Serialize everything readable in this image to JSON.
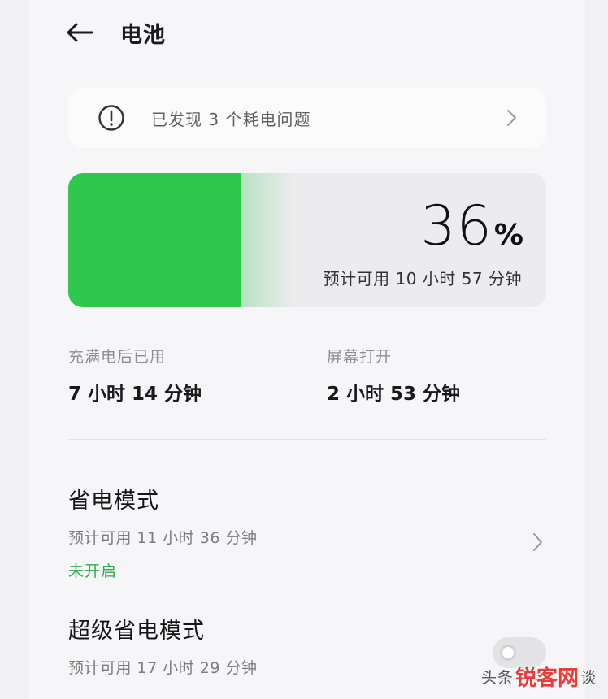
{
  "header": {
    "back_icon": "arrow-left-icon",
    "title": "电池"
  },
  "alert": {
    "icon": "exclamation-circle-icon",
    "text": "已发现 3 个耗电问题",
    "chevron_icon": "chevron-right-icon"
  },
  "battery": {
    "level_percent": 36,
    "number": "36",
    "unit": "%",
    "estimate": "预计可用 10 小时 57 分钟",
    "fill_color": "#2ec84e"
  },
  "stats": [
    {
      "label": "充满电后已用",
      "value": "7 小时 14 分钟"
    },
    {
      "label": "屏幕打开",
      "value": "2 小时 53 分钟"
    }
  ],
  "settings": {
    "power_saving": {
      "title": "省电模式",
      "subtitle": "预计可用 11 小时 36 分钟",
      "status": "未开启",
      "status_color": "#2eaa4a",
      "chevron_icon": "chevron-right-icon"
    },
    "super_power_saving": {
      "title": "超级省电模式",
      "subtitle": "预计可用 17 小时 29 分钟",
      "toggle_on": false
    }
  },
  "watermark": {
    "prefix": "头条",
    "logo": "锐客网",
    "suffix": "谈"
  }
}
